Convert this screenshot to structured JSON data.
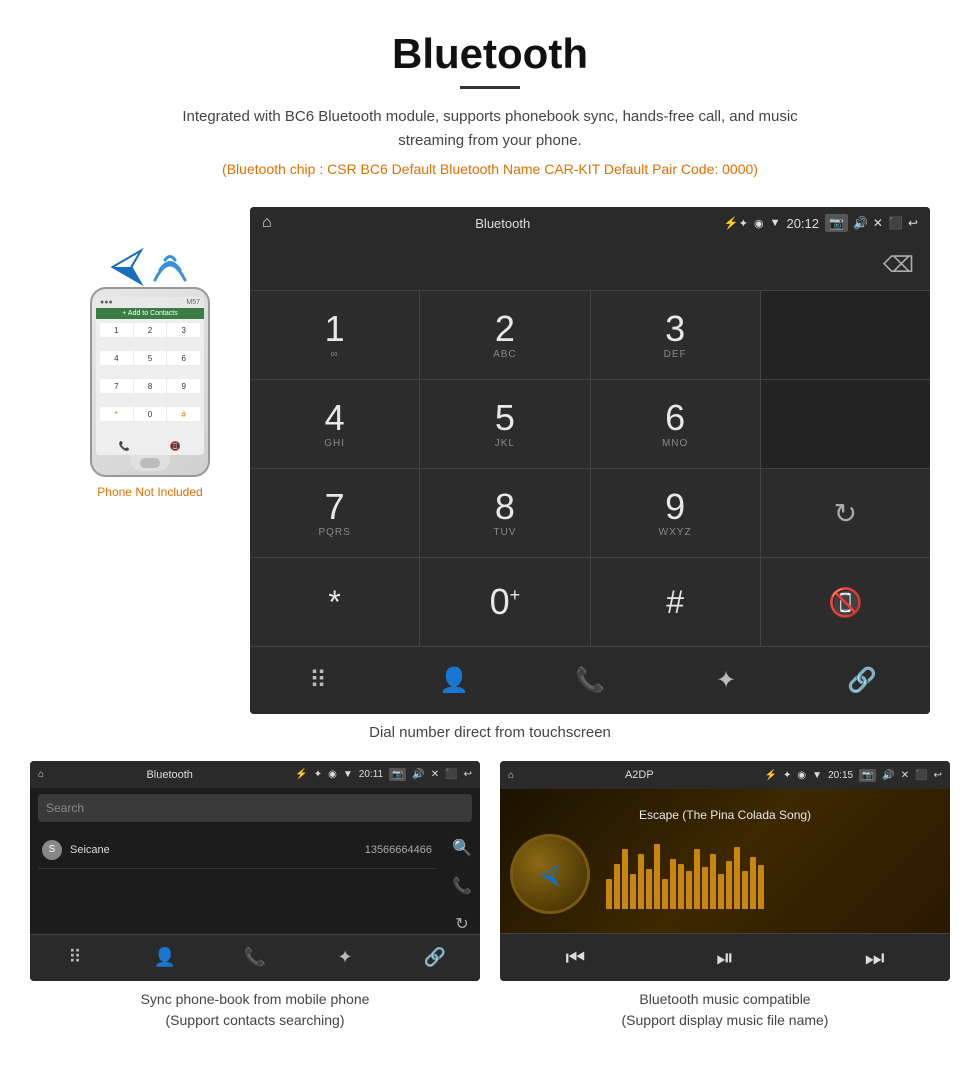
{
  "page": {
    "title": "Bluetooth",
    "subtitle": "Integrated with BC6 Bluetooth module, supports phonebook sync, hands-free call, and music streaming from your phone.",
    "info_line": "(Bluetooth chip : CSR BC6    Default Bluetooth Name CAR-KIT    Default Pair Code: 0000)",
    "dial_caption": "Dial number direct from touchscreen",
    "phone_not_included": "Phone Not Included",
    "bottom_left_caption": "Sync phone-book from mobile phone\n(Support contacts searching)",
    "bottom_right_caption": "Bluetooth music compatible\n(Support display music file name)"
  },
  "dial_screen": {
    "status_title": "Bluetooth",
    "time": "20:12",
    "keypad": [
      {
        "number": "1",
        "letters": "∞"
      },
      {
        "number": "2",
        "letters": "ABC"
      },
      {
        "number": "3",
        "letters": "DEF"
      },
      {
        "number": "",
        "letters": ""
      },
      {
        "number": "4",
        "letters": "GHI"
      },
      {
        "number": "5",
        "letters": "JKL"
      },
      {
        "number": "6",
        "letters": "MNO"
      },
      {
        "number": "",
        "letters": ""
      },
      {
        "number": "7",
        "letters": "PQRS"
      },
      {
        "number": "8",
        "letters": "TUV"
      },
      {
        "number": "9",
        "letters": "WXYZ"
      },
      {
        "number": "",
        "letters": "refresh"
      },
      {
        "number": "*",
        "letters": ""
      },
      {
        "number": "0",
        "letters": "+"
      },
      {
        "number": "#",
        "letters": ""
      },
      {
        "number": "",
        "letters": "call"
      }
    ]
  },
  "phonebook_screen": {
    "status_title": "Bluetooth",
    "time": "20:11",
    "search_placeholder": "Search",
    "contact_name": "Seicane",
    "contact_letter": "S",
    "contact_number": "13566664466"
  },
  "music_screen": {
    "status_title": "A2DP",
    "time": "20:15",
    "song_title": "Escape (The Pina Colada Song)",
    "visualizer_bars": [
      30,
      45,
      60,
      35,
      55,
      40,
      65,
      30,
      50,
      45,
      38,
      60,
      42,
      55,
      35,
      48,
      62,
      38,
      52,
      44
    ]
  }
}
